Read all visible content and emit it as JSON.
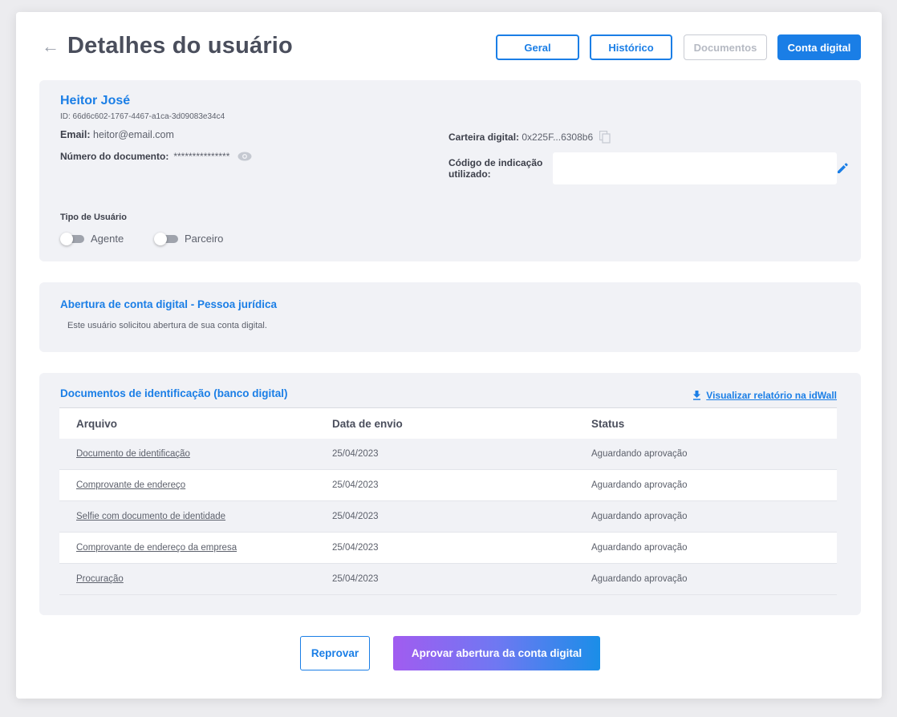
{
  "header": {
    "title": "Detalhes do usuário",
    "tabs": [
      {
        "label": "Geral"
      },
      {
        "label": "Histórico"
      },
      {
        "label": "Documentos"
      },
      {
        "label": "Conta digital"
      }
    ]
  },
  "user": {
    "name": "Heitor José",
    "id": "ID: 66d6c602-1767-4467-a1ca-3d09083e34c4",
    "email_label": "Email:",
    "email": "heitor@email.com",
    "document_label": "Número do documento:",
    "document_value": "***************",
    "wallet_label": "Carteira digital:",
    "wallet_value": "0x225F...6308b6",
    "referral_label": "Código de indicação utilizado:",
    "referral_value": "",
    "user_type_label": "Tipo de Usuário",
    "toggles": [
      {
        "label": "Agente"
      },
      {
        "label": "Parceiro"
      }
    ]
  },
  "account": {
    "title": "Abertura de conta digital - Pessoa jurídica",
    "text": "Este usuário solicitou abertura de sua conta digital."
  },
  "documents": {
    "title": "Documentos de identificação (banco digital)",
    "report_link": "Visualizar relatório na idWall",
    "columns": [
      "Arquivo",
      "Data de envio",
      "Status"
    ],
    "rows": [
      {
        "file": "Documento de identificação",
        "date": "25/04/2023",
        "status": "Aguardando aprovação"
      },
      {
        "file": "Comprovante de endereço",
        "date": "25/04/2023",
        "status": "Aguardando aprovação"
      },
      {
        "file": "Selfie com documento de identidade",
        "date": "25/04/2023",
        "status": "Aguardando aprovação"
      },
      {
        "file": "Comprovante de endereço da empresa",
        "date": "25/04/2023",
        "status": "Aguardando aprovação"
      },
      {
        "file": "Procuração",
        "date": "25/04/2023",
        "status": "Aguardando aprovação"
      }
    ]
  },
  "actions": {
    "reject_label": "Reprovar",
    "approve_label": "Aprovar abertura da conta digital"
  },
  "colors": {
    "accent": "#1a7ee6",
    "section_bg": "#f1f2f6",
    "gradient_start": "#a15cf0",
    "gradient_end": "#1a8ee8"
  },
  "icons": [
    "back-arrow-icon",
    "eye-icon",
    "copy-icon",
    "pencil-icon",
    "download-icon"
  ]
}
